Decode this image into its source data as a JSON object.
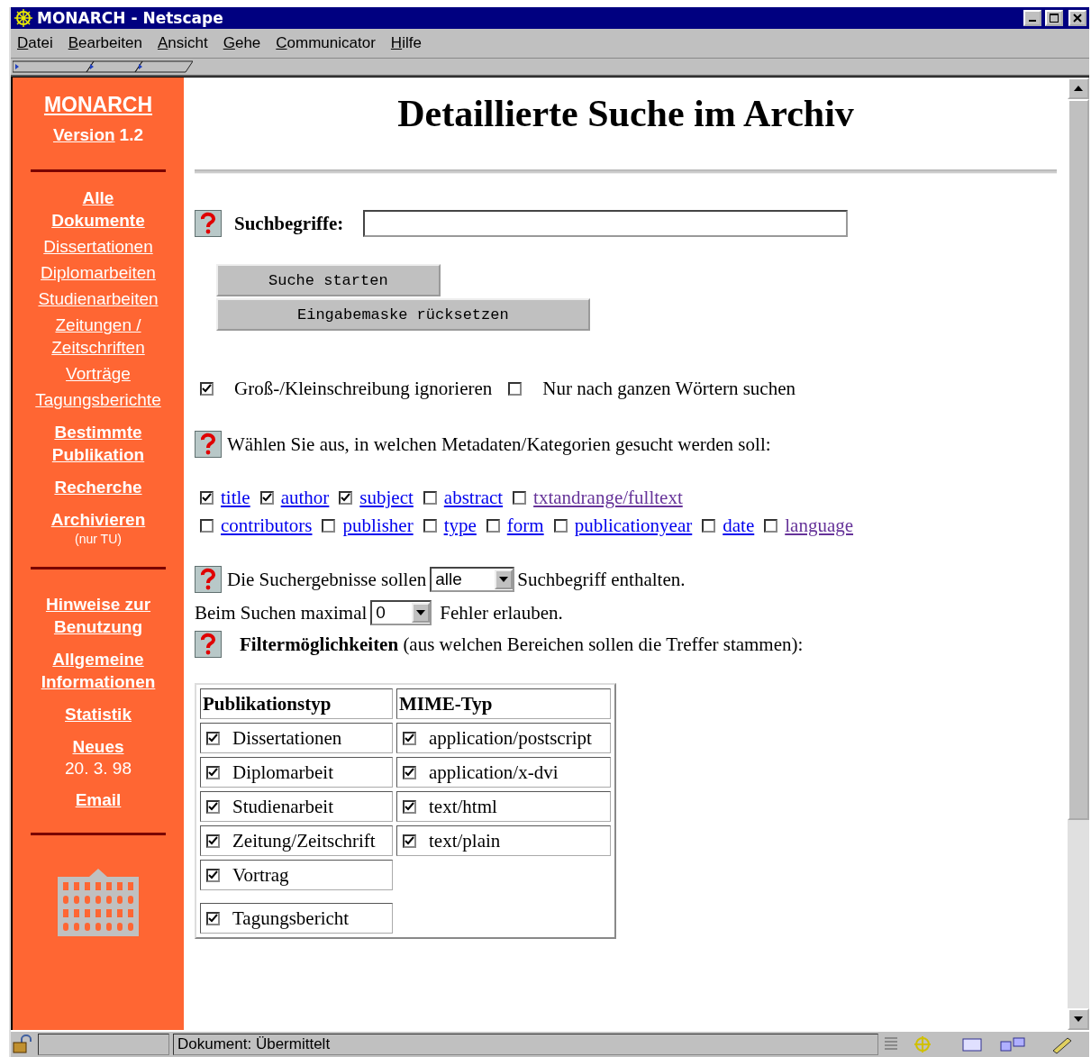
{
  "window": {
    "title": "MONARCH - Netscape"
  },
  "menu": [
    "Datei",
    "Bearbeiten",
    "Ansicht",
    "Gehe",
    "Communicator",
    "Hilfe"
  ],
  "sidebar": {
    "title": "MONARCH",
    "version_link": "Version",
    "version_number": "1.2",
    "groups": [
      [
        {
          "label": "Alle Dokumente",
          "kind": "major"
        },
        {
          "label": "Dissertationen",
          "kind": "minor"
        },
        {
          "label": "Diplomarbeiten",
          "kind": "minor"
        },
        {
          "label": "Studienarbeiten",
          "kind": "minor"
        },
        {
          "label": "Zeitungen / Zeitschriften",
          "kind": "minor"
        },
        {
          "label": "Vorträge",
          "kind": "minor"
        },
        {
          "label": "Tagungsberichte",
          "kind": "minor"
        },
        {
          "label": "Bestimmte Publikation",
          "kind": "major"
        },
        {
          "label": "Recherche",
          "kind": "major"
        },
        {
          "label": "Archivieren",
          "kind": "major",
          "note": "(nur TU)"
        }
      ],
      [
        {
          "label": "Hinweise zur Benutzung",
          "kind": "major"
        },
        {
          "label": "Allgemeine Informationen",
          "kind": "major"
        },
        {
          "label": "Statistik",
          "kind": "major"
        },
        {
          "label": "Neues",
          "kind": "major",
          "note": "20. 3. 98"
        },
        {
          "label": "Email",
          "kind": "major"
        }
      ]
    ]
  },
  "heading": "Detaillierte Suche im Archiv",
  "search": {
    "label": "Suchbegriffe:"
  },
  "buttons": [
    "Suche starten",
    "Eingabemaske rücksetzen"
  ],
  "options": [
    {
      "label": "Groß-/Kleinschreibung ignorieren",
      "checked": true
    },
    {
      "label": "Nur nach ganzen Wörtern suchen",
      "checked": false
    }
  ],
  "metadata_prompt": "Wählen Sie aus, in welchen Metadaten/Kategorien gesucht werden soll:",
  "metadata_rows": [
    [
      {
        "label": "title",
        "checked": true,
        "visited": false
      },
      {
        "label": "author",
        "checked": true,
        "visited": false
      },
      {
        "label": "subject",
        "checked": true,
        "visited": false
      },
      {
        "label": "abstract",
        "checked": false,
        "visited": false
      },
      {
        "label": "txtandrange/fulltext",
        "checked": false,
        "visited": true
      }
    ],
    [
      {
        "label": "contributors",
        "checked": false,
        "visited": false
      },
      {
        "label": "publisher",
        "checked": false,
        "visited": false
      },
      {
        "label": "type",
        "checked": false,
        "visited": false
      },
      {
        "label": "form",
        "checked": false,
        "visited": false
      },
      {
        "label": "publicationyear",
        "checked": false,
        "visited": false
      },
      {
        "label": "date",
        "checked": false,
        "visited": false
      },
      {
        "label": "language",
        "checked": false,
        "visited": true
      }
    ]
  ],
  "results_line": {
    "before": "Die Suchergebnisse sollen",
    "value": "alle",
    "after": "Suchbegriff enthalten."
  },
  "errors_line": {
    "before": "Beim Suchen maximal",
    "value": "0",
    "after": "Fehler erlauben."
  },
  "filter_text": "**Filtermöglichkeiten** (aus welchen Bereichen sollen die Treffer stammen):",
  "filter_table": {
    "columns": [
      {
        "heading": "Publikationstyp",
        "items": [
          {
            "label": "Dissertationen",
            "checked": true
          },
          {
            "label": "Diplomarbeit",
            "checked": true
          },
          {
            "label": "Studienarbeit",
            "checked": true
          },
          {
            "label": "Zeitung/Zeitschrift",
            "checked": true
          },
          {
            "label": "Vortrag",
            "checked": true
          },
          {
            "label": "Tagungsbericht",
            "checked": true
          }
        ]
      },
      {
        "heading": "MIME-Typ",
        "items": [
          {
            "label": "application/postscript",
            "checked": true
          },
          {
            "label": "application/x-dvi",
            "checked": true
          },
          {
            "label": "text/html",
            "checked": true
          },
          {
            "label": "text/plain",
            "checked": true
          }
        ]
      }
    ]
  },
  "status_bar": {
    "text": "Dokument: Übermittelt"
  }
}
